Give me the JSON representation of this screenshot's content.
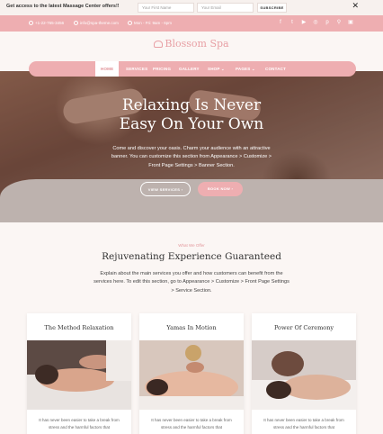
{
  "promo": {
    "message": "Get access to the latest Massage Center offers!!",
    "first_name_placeholder": "Your First Name",
    "email_placeholder": "Your Email",
    "subscribe_label": "SUBSCRIBE",
    "close_glyph": "✕"
  },
  "contact": {
    "phone": "+1-22-765-3456",
    "email": "info@spa-theme.com",
    "hours": "Mon - Fri: 9am - 6pm",
    "socials": [
      "facebook-icon",
      "twitter-icon",
      "youtube-icon",
      "instagram-icon",
      "pinterest-icon",
      "search-icon",
      "cart-icon"
    ]
  },
  "logo": {
    "text": "Blossom Spa"
  },
  "nav": {
    "items": [
      {
        "label": "HOME"
      },
      {
        "label": "SERVICES"
      },
      {
        "label": "PRICING"
      },
      {
        "label": "GALLERY"
      },
      {
        "label": "SHOP ⌄"
      },
      {
        "label": "PAGES ⌄"
      },
      {
        "label": "CONTACT"
      }
    ]
  },
  "hero": {
    "title_line1": "Relaxing Is Never",
    "title_line2": "Easy On Your Own",
    "description": "Come and discover your oasis. Charm your audience with an attractive banner. You can customize this section from Appearance > Customize > Front Page Settings > Banner Section.",
    "btn_primary": "VIEW SERVICES ›",
    "btn_secondary": "BOOK NOW ›"
  },
  "services": {
    "eyebrow": "What We Offer",
    "title": "Rejuvenating Experience Guaranteed",
    "description": "Explain about the main services you offer and how customers can benefit from the services here. To edit this section, go to Appearance > Customize > Front Page Settings > Service Section.",
    "cards": [
      {
        "title": "The Method Relaxation",
        "text": "It has never been easier to take a break from stress and the harmful factors that"
      },
      {
        "title": "Yamas In Motion",
        "text": "It has never been easier to take a break from stress and the harmful factors that"
      },
      {
        "title": "Power Of Ceremony",
        "text": "It has never been easier to take a break from stress and the harmful factors that"
      }
    ]
  },
  "colors": {
    "accent": "#eeaeb1",
    "accent_dark": "#e08f95",
    "background": "#fbf6f4"
  }
}
